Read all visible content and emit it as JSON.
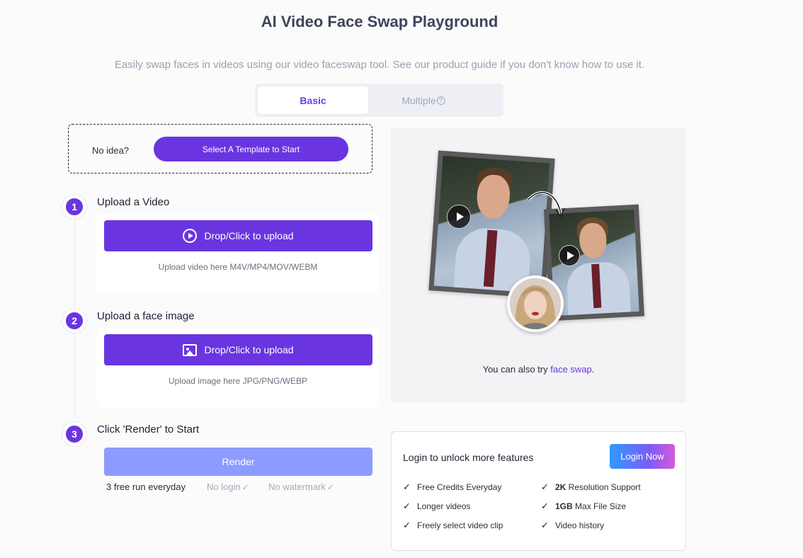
{
  "header": {
    "title": "AI Video Face Swap Playground",
    "subtitle": "Easily swap faces in videos using our video faceswap tool. See our product guide if you don't know how to use it."
  },
  "tabs": [
    {
      "label": "Basic",
      "active": true
    },
    {
      "label": "Multiple",
      "active": false
    }
  ],
  "template": {
    "prompt": "No idea?",
    "button_label": "Select A Template to Start"
  },
  "steps": [
    {
      "number": "1",
      "title": "Upload a Video",
      "button_label": "Drop/Click to upload",
      "hint": "Upload video here M4V/MP4/MOV/WEBM"
    },
    {
      "number": "2",
      "title": "Upload a face image",
      "button_label": "Drop/Click to upload",
      "hint": "Upload image here JPG/PNG/WEBP"
    },
    {
      "number": "3",
      "title": "Click 'Render' to Start"
    }
  ],
  "render": {
    "button_label": "Render",
    "free_run": "3 free run everyday",
    "no_login": "No login",
    "no_watermark": "No watermark"
  },
  "preview": {
    "also_try_prefix": "You can also try ",
    "also_try_link": "face swap",
    "also_try_suffix": "."
  },
  "login": {
    "title": "Login to unlock more features",
    "button_label": "Login Now",
    "features_left": [
      "Free Credits Everyday",
      "Longer videos",
      "Freely select video clip"
    ],
    "features_right": [
      {
        "bold": "2K",
        "text": " Resolution Support"
      },
      {
        "bold": "1GB",
        "text": " Max File Size"
      },
      {
        "bold": "",
        "text": "Video history"
      }
    ]
  },
  "colors": {
    "accent": "#6a35e0",
    "render_disabled": "#8c9bff",
    "background": "#fbfbfc"
  }
}
